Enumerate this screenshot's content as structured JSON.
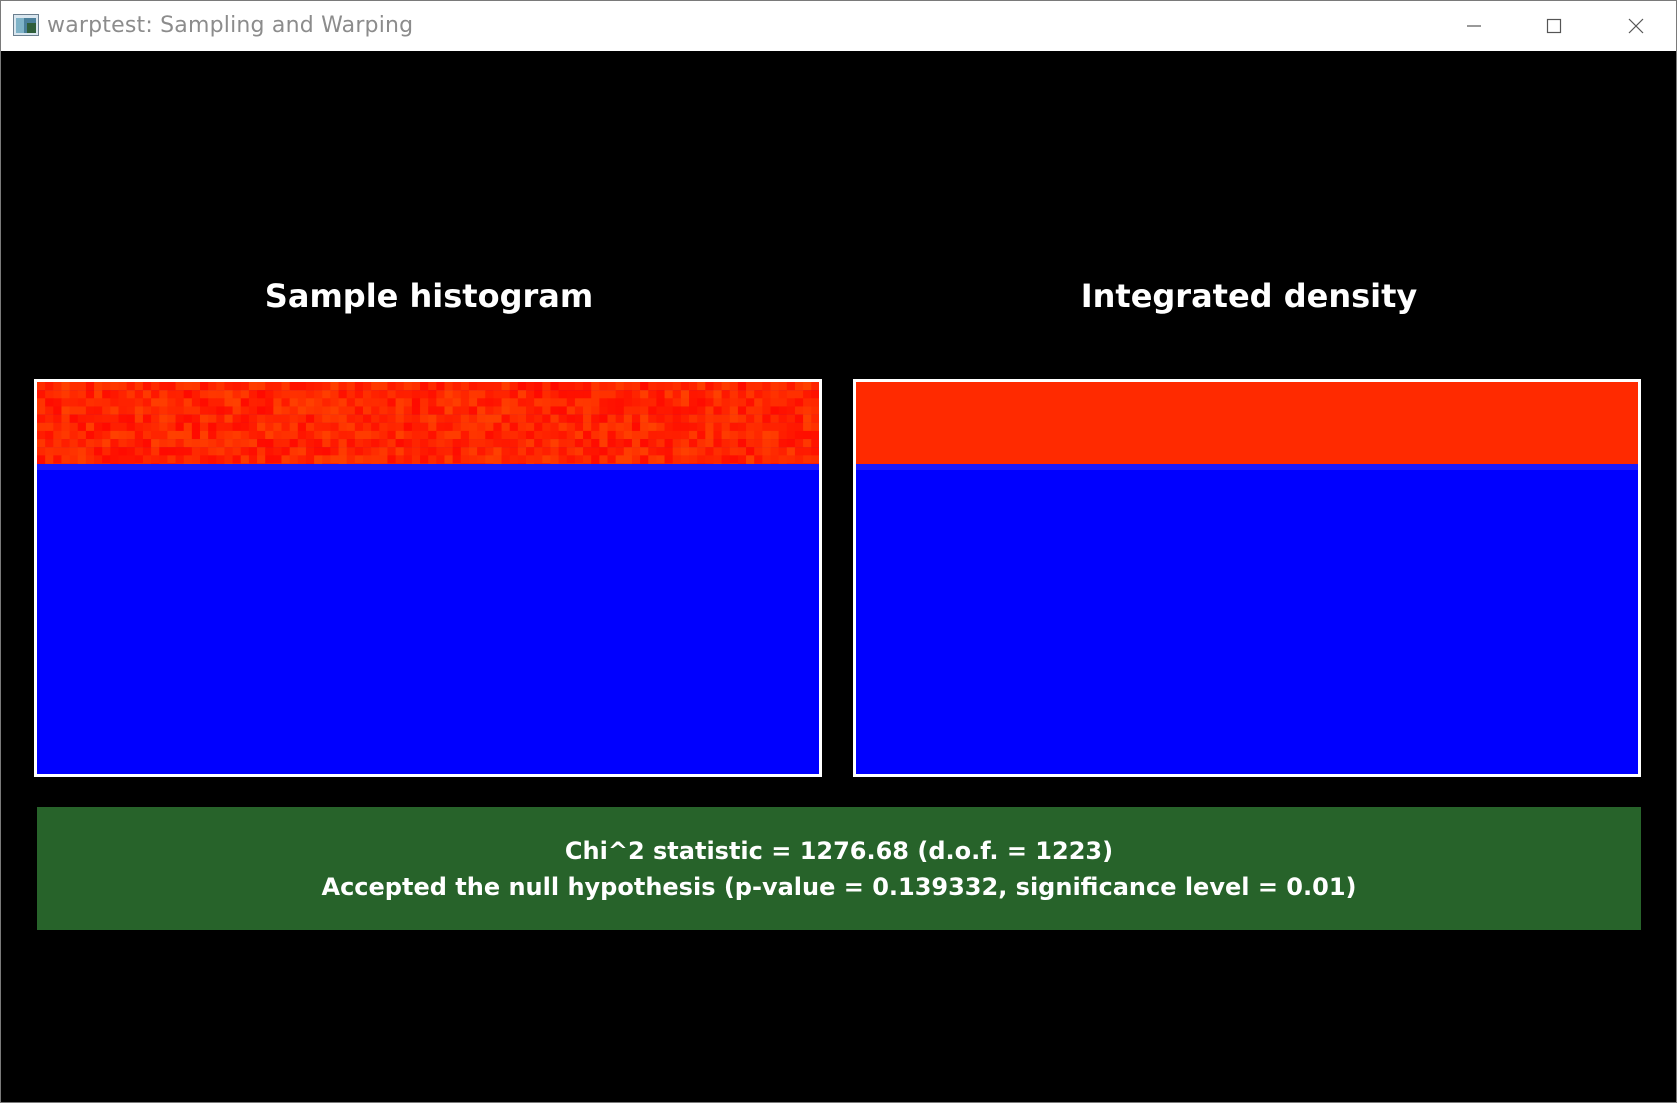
{
  "window": {
    "title": "warptest: Sampling and Warping",
    "buttons": {
      "minimize_icon": "minimize-icon",
      "maximize_icon": "maximize-icon",
      "close_icon": "close-icon"
    }
  },
  "panels": {
    "left_title": "Sample histogram",
    "right_title": "Integrated density"
  },
  "colors": {
    "background": "#000000",
    "plot_low": "#0000ff",
    "plot_high": "#ff2a00",
    "plot_band": "#1a1aff",
    "result_bar": "#27632a",
    "text": "#ffffff"
  },
  "result": {
    "line1": "Chi^2 statistic = 1276.68 (d.o.f. = 1223)",
    "line2": "Accepted the null hypothesis (p-value = 0.139332, significance level = 0.01)"
  }
}
